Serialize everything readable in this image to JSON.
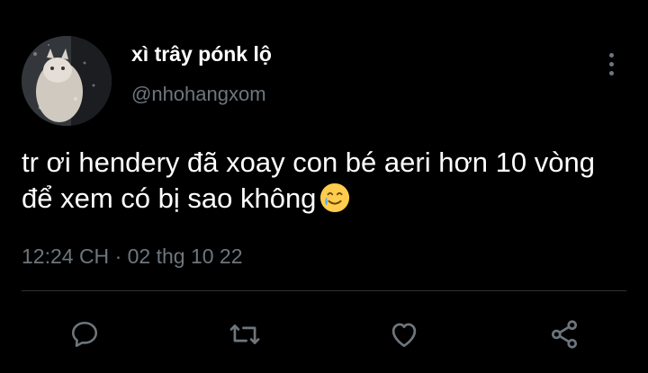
{
  "tweet": {
    "display_name": "xì trây pónk lộ",
    "handle": "@nhohangxom",
    "text": "tr ơi hendery đã xoay con bé aeri hơn 10 vòng để xem có bị sao không",
    "emoji": "smiling-face-with-tear",
    "time": "12:24 CH",
    "separator": "·",
    "date": "02 thg 10 22"
  },
  "actions": [
    "reply-icon",
    "retweet-icon",
    "like-icon",
    "share-icon"
  ],
  "colors": {
    "background": "#000000",
    "text_primary": "#ffffff",
    "text_secondary": "#6e767d",
    "divider": "#2f3336"
  }
}
